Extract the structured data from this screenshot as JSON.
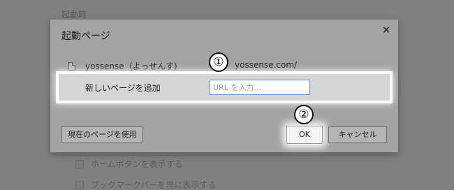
{
  "background": {
    "section_heading": "起動時",
    "options": [
      "ホームボタンを表示する",
      "ブックマークバーを常に表示する"
    ]
  },
  "dialog": {
    "title": "起動ページ",
    "close_icon": "close-icon",
    "pages": [
      {
        "name": "yossense（よっせんす)",
        "url": "yossense.com/"
      }
    ],
    "add_row": {
      "label": "新しいページを追加",
      "input_value": "",
      "input_placeholder": "URL を入力..."
    },
    "buttons": {
      "use_current": "現在のページを使用",
      "ok": "OK",
      "cancel": "キャンセル"
    }
  },
  "annotations": {
    "marker_1": "①",
    "marker_2": "②"
  },
  "colors": {
    "overlay": "#808080",
    "dialog_dimmed": "#a3a3a3",
    "highlight_row": "#d5d5d5",
    "input_border": "#6b8fd6",
    "highlight_glow": "#ffffff"
  }
}
